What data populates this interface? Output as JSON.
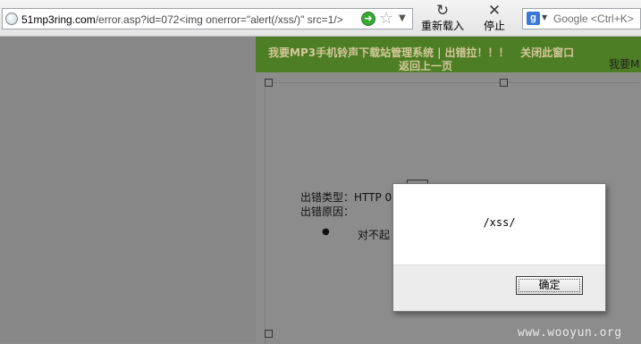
{
  "browser": {
    "url_host": "51mp3ring.com",
    "url_rest": "/error.asp?id=072<img onerror=\"alert(/xss/)\" src=1/>",
    "reload_label": "重新载入",
    "stop_label": "停止",
    "search_placeholder": "Google <Ctrl+K>"
  },
  "site": {
    "nav_title": "我要MP3手机铃声下载站管理系统",
    "nav_separator": "|",
    "nav_error": "出错拉！！！",
    "nav_close": "关闭此窗口",
    "nav_back": "返回上一页",
    "right_cut_text": "我要M"
  },
  "error": {
    "type_line": "出错类型：HTTP 0",
    "reason_line": "出错原因：",
    "bullet": "●",
    "sorry": "对不起"
  },
  "dialog": {
    "message": "/xss/",
    "ok_label": "确定"
  },
  "watermark": "www.wooyun.org"
}
